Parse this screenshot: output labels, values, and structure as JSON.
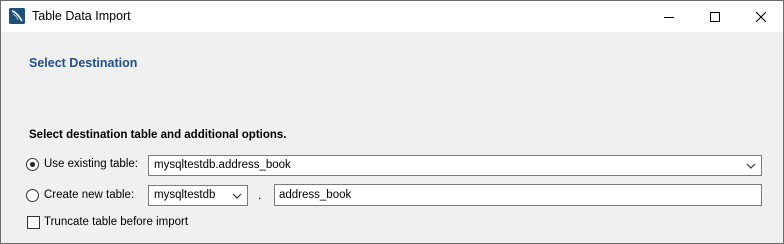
{
  "window": {
    "title": "Table Data Import",
    "icons": {
      "app": "mysql-workbench-icon",
      "minimize": "minimize-icon",
      "maximize": "maximize-icon",
      "close": "close-icon"
    }
  },
  "page": {
    "section_title": "Select Destination",
    "subtitle": "Select destination table and additional options."
  },
  "options": {
    "use_existing": {
      "label": "Use existing table:",
      "selected": true,
      "table_value": "mysqltestdb.address_book"
    },
    "create_new": {
      "label": "Create new table:",
      "selected": false,
      "schema_value": "mysqltestdb",
      "separator": ".",
      "table_name_value": "address_book"
    },
    "truncate": {
      "label": "Truncate table before import",
      "checked": false
    }
  },
  "colors": {
    "section_title": "#1e4f8c",
    "dialog_background": "#f0f0f0"
  }
}
